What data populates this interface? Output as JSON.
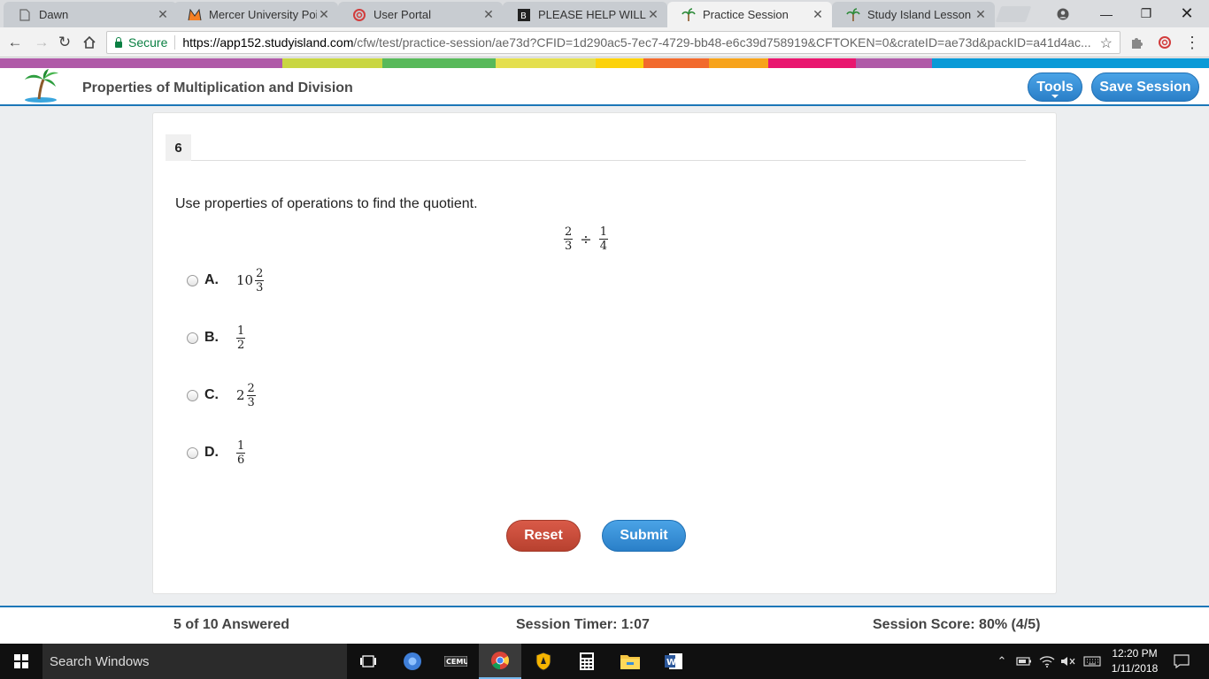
{
  "browser": {
    "tabs": [
      {
        "title": "Dawn",
        "icon": "doc-icon"
      },
      {
        "title": "Mercer University Point",
        "icon": "mercer-icon"
      },
      {
        "title": "User Portal",
        "icon": "portal-icon"
      },
      {
        "title": "PLEASE HELP WILL GIVE",
        "icon": "brainly-icon"
      },
      {
        "title": "Practice Session",
        "icon": "palm-icon"
      },
      {
        "title": "Study Island Lesson",
        "icon": "palm-icon"
      }
    ],
    "active_tab": 4,
    "secure_label": "Secure",
    "url_host": "https://app152.studyisland.com",
    "url_path": "/cfw/test/practice-session/ae73d?CFID=1d290ac5-7ec7-4729-bb48-e6c39d758919&CFTOKEN=0&crateID=ae73d&packID=a41d4ac..."
  },
  "rainbow_colors": [
    "#b05aa8",
    "#c9d642",
    "#58b95a",
    "#e4df4e",
    "#fcd20b",
    "#f26a2d",
    "#f7a31b",
    "#e9176f",
    "#b05aa8",
    "#0a9ad7"
  ],
  "header": {
    "title": "Properties of Multiplication and Division",
    "tools_label": "Tools",
    "save_label": "Save Session"
  },
  "question": {
    "number": "6",
    "prompt": "Use properties of operations to find the quotient.",
    "expression": {
      "left_num": "2",
      "left_den": "3",
      "operator": "÷",
      "right_num": "1",
      "right_den": "4"
    },
    "choices": [
      {
        "letter": "A.",
        "whole": "10",
        "num": "2",
        "den": "3"
      },
      {
        "letter": "B.",
        "whole": "",
        "num": "1",
        "den": "2"
      },
      {
        "letter": "C.",
        "whole": "2",
        "num": "2",
        "den": "3"
      },
      {
        "letter": "D.",
        "whole": "",
        "num": "1",
        "den": "6"
      }
    ],
    "reset_label": "Reset",
    "submit_label": "Submit"
  },
  "footer": {
    "answered": "5 of 10 Answered",
    "timer": "Session Timer: 1:07",
    "score": "Session Score: 80% (4/5)"
  },
  "taskbar": {
    "search_placeholder": "Search Windows",
    "time": "12:20 PM",
    "date": "1/11/2018"
  },
  "colors": {
    "accent_blue": "#2a7fc8",
    "reset_red": "#c44b39",
    "secure_green": "#0b8043"
  }
}
